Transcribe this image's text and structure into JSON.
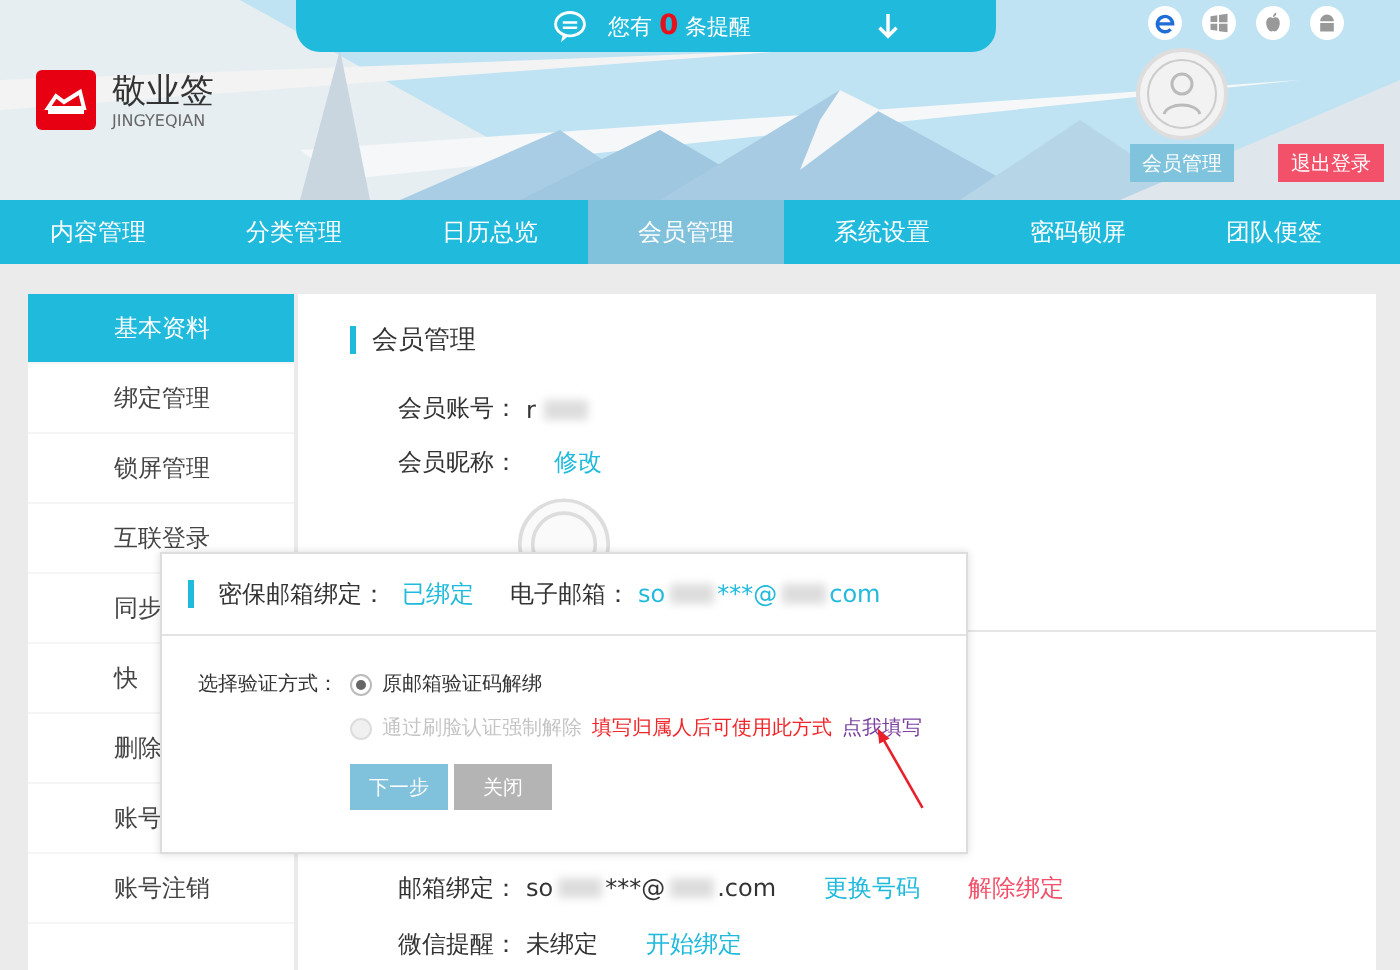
{
  "header": {
    "logo": {
      "name": "敬业签",
      "subtitle": "JINGYEQIAN"
    },
    "notice": {
      "before": "您有",
      "count": "0",
      "after": "条提醒"
    },
    "account_buttons": [
      {
        "label": "会员管理",
        "kind": "primary"
      },
      {
        "label": "退出登录",
        "kind": "danger"
      }
    ]
  },
  "nav": [
    {
      "label": "内容管理",
      "selected": false
    },
    {
      "label": "分类管理",
      "selected": false
    },
    {
      "label": "日历总览",
      "selected": false
    },
    {
      "label": "会员管理",
      "selected": true
    },
    {
      "label": "系统设置",
      "selected": false
    },
    {
      "label": "密码锁屏",
      "selected": false
    },
    {
      "label": "团队便签",
      "selected": false
    }
  ],
  "sidebar": [
    {
      "label": "基本资料",
      "selected": true
    },
    {
      "label": "绑定管理",
      "selected": false
    },
    {
      "label": "锁屏管理",
      "selected": false
    },
    {
      "label": "互联登录",
      "selected": false
    },
    {
      "label": "同步",
      "selected": false
    },
    {
      "label": "快",
      "selected": false
    },
    {
      "label": "删除",
      "selected": false
    },
    {
      "label": "账号",
      "selected": false
    },
    {
      "label": "账号注销",
      "selected": false
    }
  ],
  "main": {
    "title": "会员管理",
    "account_label": "会员账号：",
    "account_value": "r",
    "nickname_label": "会员昵称：",
    "nickname_link": "修改",
    "bindings": [
      {
        "label": "邮箱绑定：",
        "value_parts": [
          "so",
          "***@",
          ".com"
        ],
        "links": [
          {
            "label": "更换号码",
            "kind": "normal"
          },
          {
            "label": "解除绑定",
            "kind": "danger"
          }
        ]
      },
      {
        "label": "微信提醒：",
        "value_parts": [
          "未绑定"
        ],
        "links": [
          {
            "label": "开始绑定",
            "kind": "normal"
          }
        ]
      }
    ]
  },
  "dialog": {
    "header_label": "密保邮箱绑定：",
    "header_status": "已绑定",
    "email_label": "电子邮箱：",
    "email_parts": [
      "so",
      "***@",
      "com"
    ],
    "method_label": "选择验证方式：",
    "options": [
      {
        "label": "原邮箱验证码解绑",
        "selected": true,
        "disabled": false
      },
      {
        "label": "通过刷脸认证强制解除",
        "selected": false,
        "disabled": true,
        "note": "填写归属人后可使用此方式",
        "link": "点我填写"
      }
    ],
    "buttons": [
      {
        "label": "下一步",
        "kind": "primary"
      },
      {
        "label": "关闭",
        "kind": "secondary"
      }
    ]
  }
}
